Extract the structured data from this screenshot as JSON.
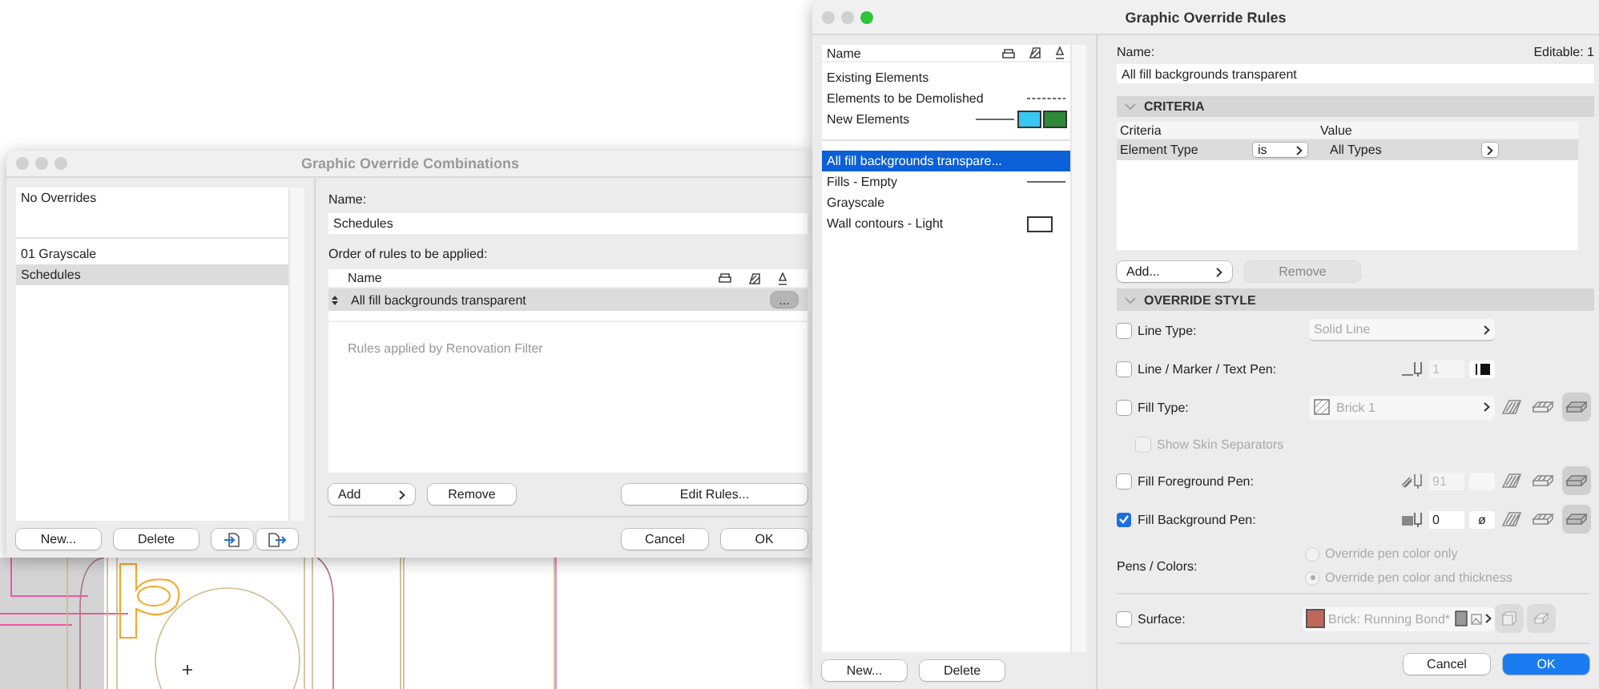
{
  "combinations_window": {
    "title": "Graphic Override Combinations",
    "combination_groups": [
      [
        {
          "label": "No Overrides",
          "selected": false
        }
      ],
      [
        {
          "label": "01 Grayscale",
          "selected": false
        },
        {
          "label": "Schedules",
          "selected": true
        }
      ]
    ],
    "list_buttons": [
      "New...",
      "Delete"
    ],
    "name_label": "Name:",
    "name_value": "Schedules",
    "rules_label": "Order of rules to be applied:",
    "rules_table": {
      "column": "Name",
      "rows": [
        {
          "name": "All fill backgrounds transparent",
          "selected": true,
          "more": "..."
        }
      ],
      "note": "Rules applied by Renovation Filter"
    },
    "add": "Add",
    "remove": "Remove",
    "edit": "Edit Rules...",
    "cancel": "Cancel",
    "ok": "OK"
  },
  "rules_window": {
    "title": "Graphic Override Rules",
    "list_column": "Name",
    "renovation_rules": [
      {
        "label": "Existing Elements",
        "kind": "none"
      },
      {
        "label": "Elements to be Demolished",
        "kind": "dashed"
      },
      {
        "label": "New Elements",
        "kind": "line_swatches",
        "swatches": [
          {
            "color": "#38c6f2"
          },
          {
            "color": "#2e8a36"
          }
        ]
      }
    ],
    "rules": [
      {
        "label": "All fill backgrounds transpare...",
        "selected": true,
        "kind": "none"
      },
      {
        "label": "Fills - Empty",
        "selected": false,
        "kind": "line"
      },
      {
        "label": "Grayscale",
        "selected": false,
        "kind": "none"
      },
      {
        "label": "Wall contours - Light",
        "selected": false,
        "kind": "box"
      }
    ],
    "list_buttons": [
      "New...",
      "Delete"
    ],
    "name_label": "Name:",
    "editable": "Editable: 1",
    "name_value": "All fill backgrounds transparent",
    "criteria": {
      "title": "CRITERIA",
      "expanded": true,
      "columns": [
        "Criteria",
        "Value"
      ],
      "rows": [
        {
          "criterion": "Element Type",
          "operator": "is",
          "value": "All Types",
          "selected": true
        }
      ],
      "add": "Add...",
      "remove": "Remove"
    },
    "override_style": {
      "title": "OVERRIDE STYLE",
      "expanded": true,
      "rows": [
        {
          "kind": "select",
          "label": "Line Type:",
          "checked": false,
          "value": "Solid Line"
        },
        {
          "kind": "line_pen",
          "label": "Line / Marker / Text Pen:",
          "checked": false,
          "pen": "1"
        },
        {
          "kind": "fill",
          "label": "Fill Type:",
          "checked": false,
          "value": "Brick 1"
        },
        {
          "kind": "sub_check",
          "label": "Show Skin Separators",
          "checked": false
        },
        {
          "kind": "hatch_pen",
          "label": "Fill Foreground Pen:",
          "checked": false,
          "pen": "91"
        },
        {
          "kind": "solid_pen",
          "label": "Fill Background Pen:",
          "checked": true,
          "pen": "0",
          "symbol": "ø"
        },
        {
          "kind": "radio",
          "label": "Pens / Colors:",
          "options": [
            {
              "label": "Override pen color only",
              "selected": false
            },
            {
              "label": "Override pen color and thickness",
              "selected": true
            }
          ]
        },
        {
          "kind": "surface",
          "label": "Surface:",
          "checked": false,
          "value": "Brick: Running Bond*",
          "color": "#c0665a"
        }
      ]
    },
    "cancel": "Cancel",
    "ok": "OK"
  }
}
